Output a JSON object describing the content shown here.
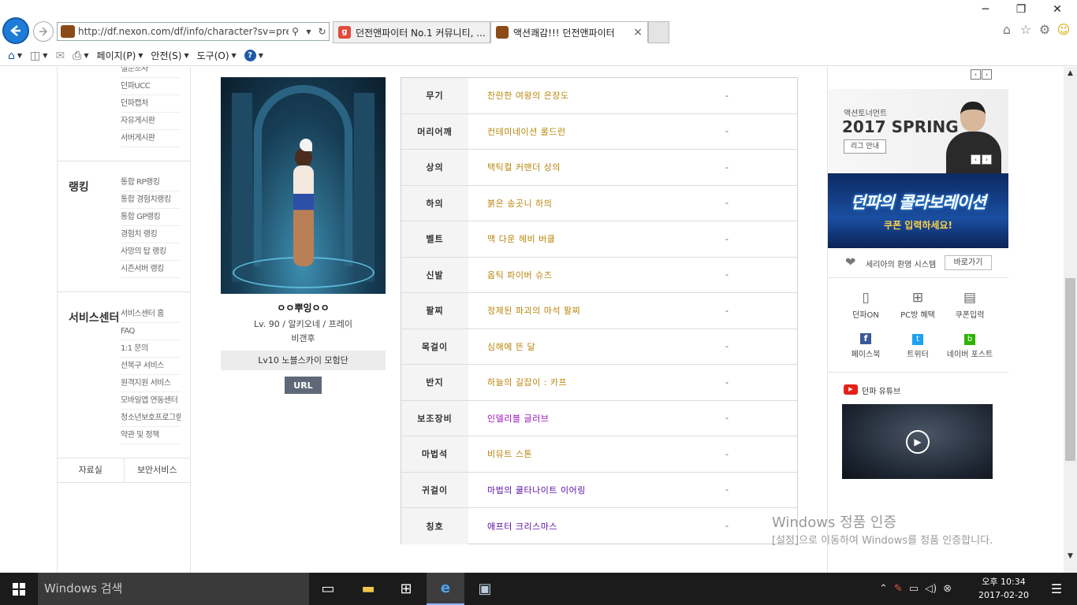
{
  "browser": {
    "address_url": "http://df.nexon.com/df/info/character?sv=prey&c",
    "tabs": [
      {
        "label": "던전앤파이터 No.1 커뮤니티, ..."
      },
      {
        "label": "액션쾌감!!! 던전앤파이터"
      }
    ],
    "commands": {
      "page": "페이지(P)",
      "safety": "안전(S)",
      "tools": "도구(O)"
    }
  },
  "leftnav": {
    "community_items": [
      "설문조사",
      "던파UCC",
      "던파캡처",
      "자유게시판",
      "서버게시판"
    ],
    "ranking": {
      "title": "랭킹",
      "items": [
        "통합 RP랭킹",
        "통합 경험치랭킹",
        "통합 GP랭킹",
        "경험치 랭킹",
        "사망의 탑 랭킹",
        "시즌서버 랭킹"
      ]
    },
    "service": {
      "title": "서비스센터",
      "items": [
        "서비스센터 홈",
        "FAQ",
        "1:1 문의",
        "선복구 서비스",
        "원격지원 서비스",
        "모바일앱 연동센터",
        "청소년보호프로그램",
        "약관 및 정책"
      ]
    },
    "bottom_links": [
      "자료실",
      "보안서비스"
    ]
  },
  "character": {
    "name": "ㅇㅇ뿌잉ㅇㅇ",
    "info": "Lv. 90 /  알키오네  /  프레이",
    "server": "비갠후",
    "guild": "Lv10  노블스카이 모험단",
    "url_button": "URL"
  },
  "equipment": [
    {
      "slot": "무기",
      "item": "찬란한 여왕의 은장도",
      "value": "-",
      "color": "#b8860b"
    },
    {
      "slot": "머리어깨",
      "item": "컨테미네이션 롤드런",
      "value": "-",
      "color": "#b8860b"
    },
    {
      "slot": "상의",
      "item": "택틱컬 커맨더 상의",
      "value": "-",
      "color": "#b8860b"
    },
    {
      "slot": "하의",
      "item": "붉은 송곳니 하의",
      "value": "-",
      "color": "#b8860b"
    },
    {
      "slot": "벨트",
      "item": "맥 다운 헤비 버클",
      "value": "-",
      "color": "#b8860b"
    },
    {
      "slot": "신발",
      "item": "옵틱 파이버 슈즈",
      "value": "-",
      "color": "#b8860b"
    },
    {
      "slot": "팔찌",
      "item": "정제된 파괴의 마석 팔찌",
      "value": "-",
      "color": "#b8860b"
    },
    {
      "slot": "목걸이",
      "item": "심해에 뜬 달",
      "value": "-",
      "color": "#b8860b"
    },
    {
      "slot": "반지",
      "item": "하늘의 길잡이 : 카프",
      "value": "-",
      "color": "#b8860b"
    },
    {
      "slot": "보조장비",
      "item": "인델리블 글러브",
      "value": "-",
      "color": "#9b10b8"
    },
    {
      "slot": "마법석",
      "item": "비뮤트 스톤",
      "value": "-",
      "color": "#b8860b"
    },
    {
      "slot": "귀걸이",
      "item": "마법의 쿨타나이트 이어링",
      "value": "-",
      "color": "#5a0fa3"
    },
    {
      "slot": "칭호",
      "item": "애프터 크리스마스",
      "value": "-",
      "color": "#5a0fa3"
    }
  ],
  "rightcol": {
    "promo": {
      "sub": "액션토너먼트",
      "title": "2017 SPRING",
      "button": "리그 안내"
    },
    "collab": {
      "title": "던파의 콜라보레이션",
      "sub": "쿠폰 입력하세요!"
    },
    "welcome": {
      "text": "세리아의 환영 시스템",
      "button": "바로가기"
    },
    "quick": [
      "던파ON",
      "PC방 혜택",
      "쿠폰입력",
      "페이스북",
      "트위터",
      "네이버 포스트"
    ],
    "youtube_label": "던파 유튜브"
  },
  "watermark": {
    "title": "Windows 정품 인증",
    "sub": "[설정]으로 이동하여 Windows를 정품 인증합니다."
  },
  "taskbar": {
    "search_placeholder": "Windows 검색",
    "clock_time": "오후 10:34",
    "clock_date": "2017-02-20"
  }
}
